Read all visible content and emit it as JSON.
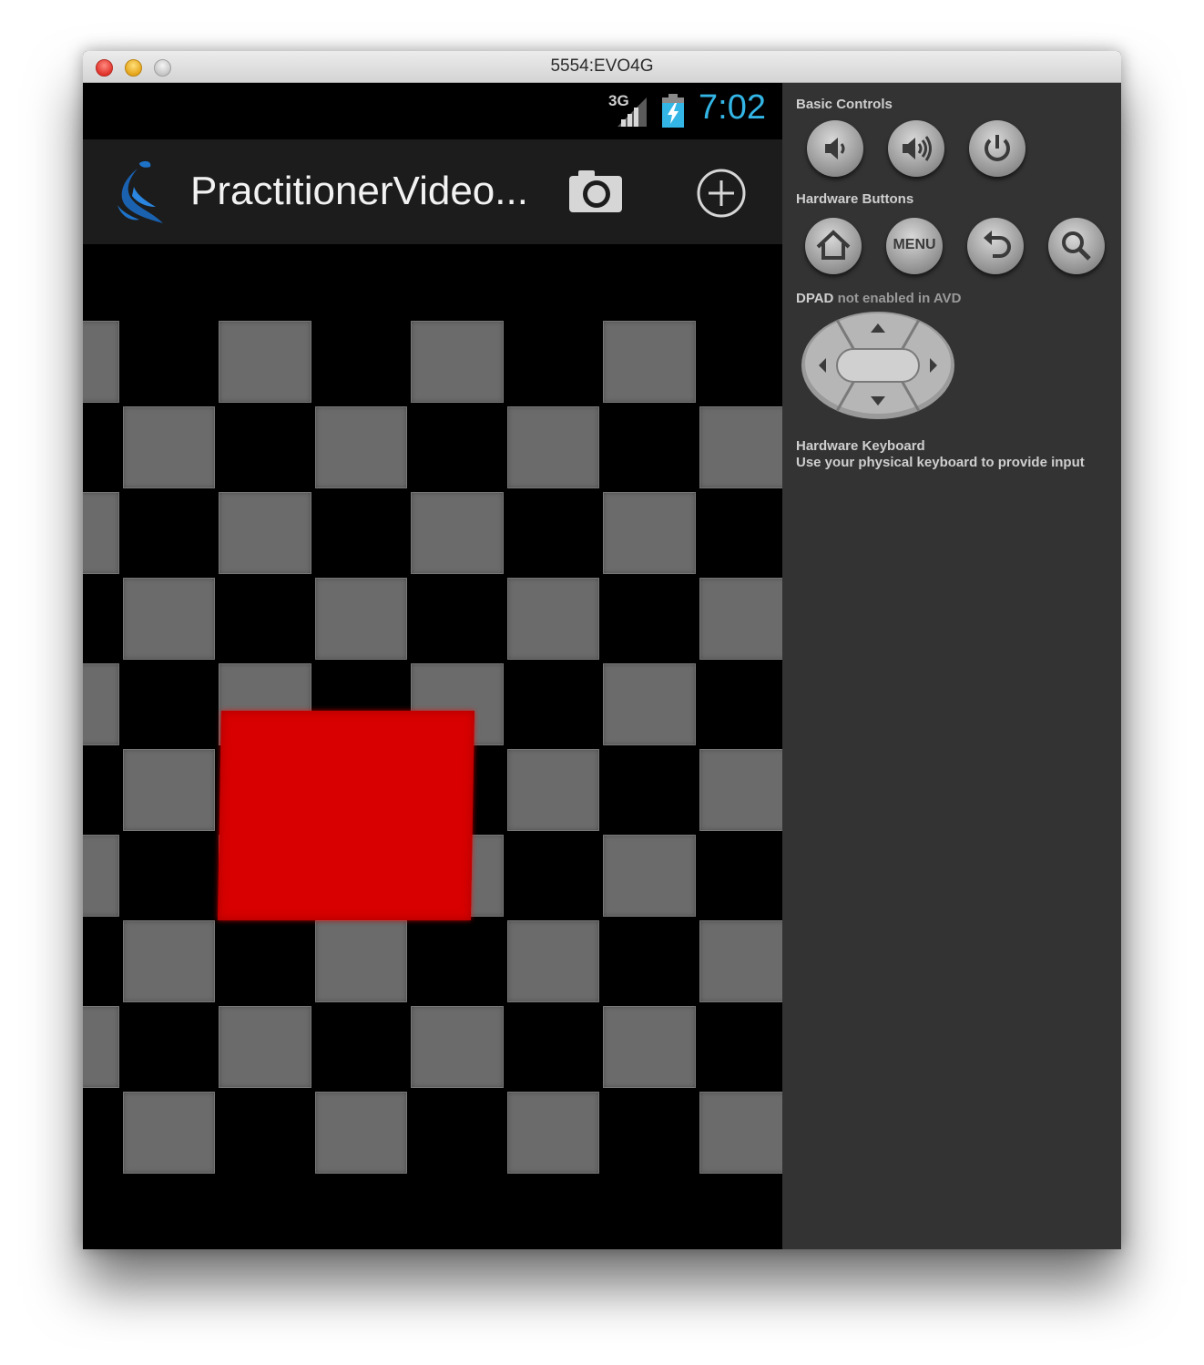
{
  "window": {
    "title": "5554:EVO4G"
  },
  "status_bar": {
    "network_type": "3G",
    "time": "7:02",
    "clock_color": "#33b5e5"
  },
  "action_bar": {
    "app_title": "PractitionerVideo...",
    "icons": [
      "app-logo-icon",
      "camera-icon",
      "add-icon"
    ]
  },
  "video": {
    "content": "checkerboard",
    "square_color": "#d80000"
  },
  "controls": {
    "basic_controls_label": "Basic Controls",
    "hardware_buttons_label": "Hardware Buttons",
    "menu_label": "MENU",
    "dpad_label": "DPAD",
    "dpad_status": "not enabled in AVD",
    "keyboard_label": "Hardware Keyboard",
    "keyboard_hint": "Use your physical keyboard to provide input",
    "basic_buttons": [
      "volume-down-icon",
      "volume-up-icon",
      "power-icon"
    ],
    "hardware_buttons": [
      "home-icon",
      "menu-button",
      "back-icon",
      "search-icon"
    ]
  }
}
